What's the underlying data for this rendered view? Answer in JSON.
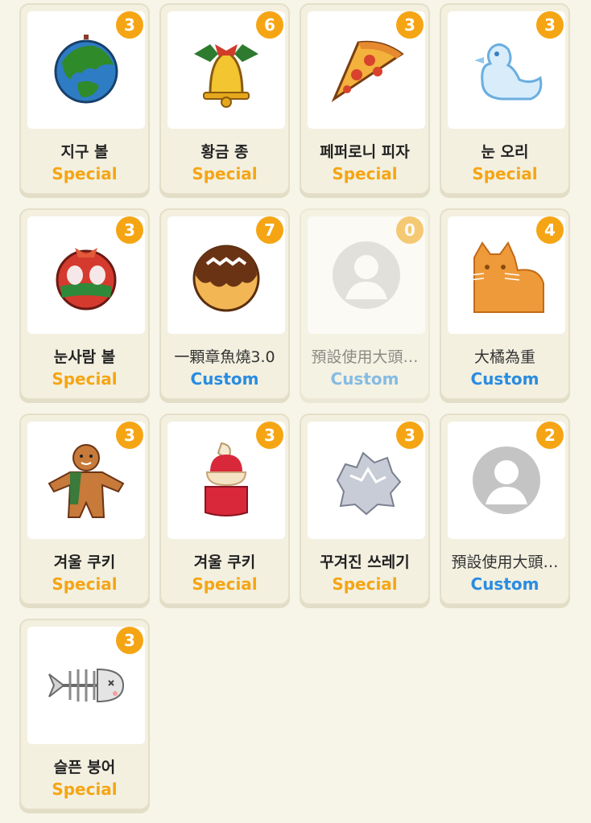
{
  "items": [
    {
      "name": "지구 볼",
      "type": "Special",
      "count": "3",
      "icon": "earth-ornament-icon"
    },
    {
      "name": "황금 종",
      "type": "Special",
      "count": "6",
      "icon": "golden-bell-icon"
    },
    {
      "name": "페퍼로니 피자",
      "type": "Special",
      "count": "3",
      "icon": "pizza-slice-icon"
    },
    {
      "name": "눈 오리",
      "type": "Special",
      "count": "3",
      "icon": "snow-duck-icon"
    },
    {
      "name": "눈사람 볼",
      "type": "Special",
      "count": "3",
      "icon": "snowman-ornament-icon"
    },
    {
      "name": "一顆章魚燒3.0",
      "type": "Custom",
      "count": "7",
      "icon": "takoyaki-icon"
    },
    {
      "name": "預設使用大頭…",
      "type": "Custom",
      "count": "0",
      "icon": "default-avatar-icon",
      "disabled": true
    },
    {
      "name": "大橘為重",
      "type": "Custom",
      "count": "4",
      "icon": "orange-cat-icon"
    },
    {
      "name": "겨울 쿠키",
      "type": "Special",
      "count": "3",
      "icon": "gingerbread-man-icon"
    },
    {
      "name": "겨울 쿠키",
      "type": "Special",
      "count": "3",
      "icon": "strawberry-cake-icon"
    },
    {
      "name": "꾸겨진 쓰레기",
      "type": "Special",
      "count": "3",
      "icon": "crumpled-paper-icon"
    },
    {
      "name": "預設使用大頭…",
      "type": "Custom",
      "count": "2",
      "icon": "default-avatar-icon"
    },
    {
      "name": "슬픈 붕어",
      "type": "Special",
      "count": "3",
      "icon": "fish-skeleton-icon"
    }
  ]
}
